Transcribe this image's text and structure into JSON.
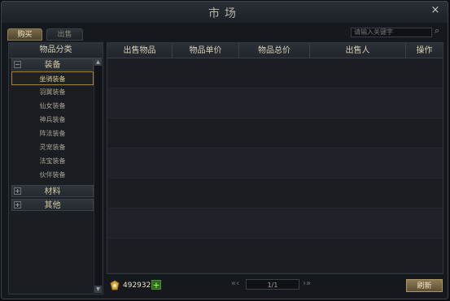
{
  "window": {
    "title": "市场",
    "close": "×"
  },
  "tabs": {
    "buy": "购买",
    "sell": "出售"
  },
  "search": {
    "placeholder": "请输入关键字"
  },
  "left": {
    "header": "物品分类",
    "categories": [
      {
        "label": "装备",
        "expanded": true,
        "children": [
          "坐骑装备",
          "羽翼装备",
          "仙女装备",
          "神兵装备",
          "阵法装备",
          "灵宠装备",
          "法宝装备",
          "伙伴装备"
        ]
      },
      {
        "label": "材料",
        "expanded": false
      },
      {
        "label": "其他",
        "expanded": false
      }
    ],
    "selected": "坐骑装备"
  },
  "table": {
    "headers": [
      "出售物品",
      "物品单价",
      "物品总价",
      "出售人",
      "操作"
    ],
    "rows": 7
  },
  "footer": {
    "gold": "492932",
    "page": "1/1",
    "refresh": "刷新"
  },
  "colors": {
    "accent": "#a8833e",
    "panel": "#1b1e23",
    "header": "#2c3137"
  }
}
